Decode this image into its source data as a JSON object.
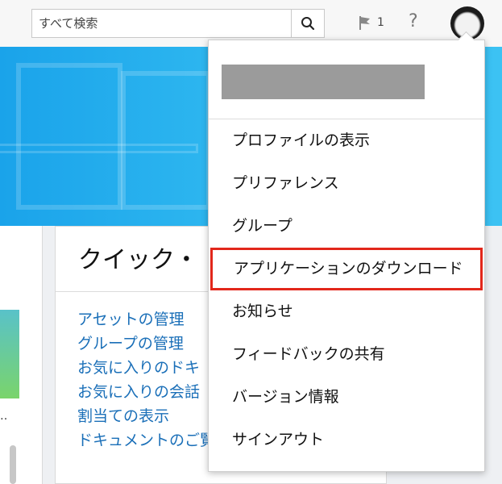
{
  "header": {
    "search_placeholder": "すべて検索",
    "search_button_icon": "search-icon",
    "flag_icon": "flag-icon",
    "notification_count": "1",
    "help_label": "?",
    "avatar_icon": "user-avatar"
  },
  "main": {
    "card_title": "クイック・",
    "links": [
      "アセットの管理",
      "グループの管理",
      "お気に入りのドキ",
      "お気に入りの会話",
      "割当ての表示",
      "ドキュメントのご覧を開く"
    ],
    "left_card_text": "‥"
  },
  "user_menu": {
    "user_name_redacted": true,
    "items": [
      {
        "label": "プロファイルの表示"
      },
      {
        "label": "プリファレンス"
      },
      {
        "label": "グループ"
      },
      {
        "label": "アプリケーションのダウンロード",
        "highlighted": true
      },
      {
        "label": "お知らせ"
      },
      {
        "label": "フィードバックの共有"
      },
      {
        "label": "バージョン情報"
      },
      {
        "label": "サインアウト"
      }
    ]
  },
  "colors": {
    "banner": "#1aa3ea",
    "link": "#1a6fb8",
    "highlight_border": "#e2271b"
  }
}
